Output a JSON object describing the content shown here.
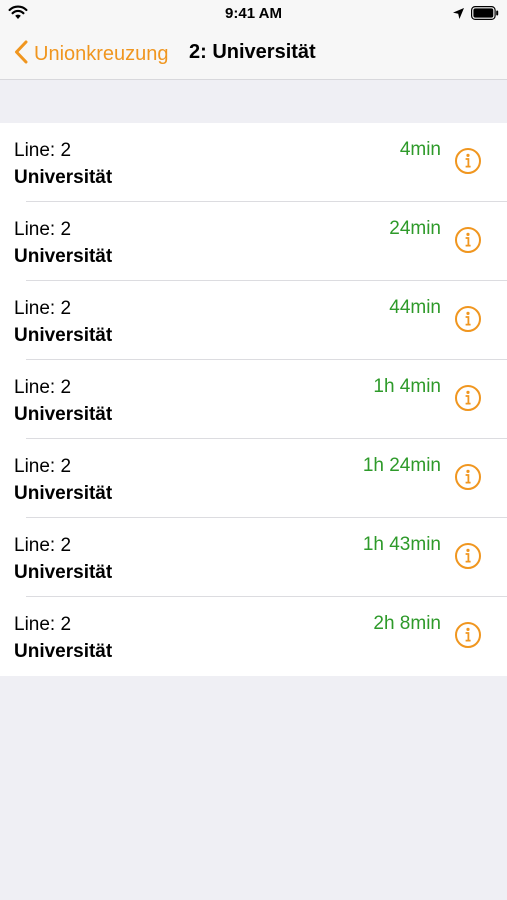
{
  "status_bar": {
    "time": "9:41 AM",
    "icons": [
      "wifi-icon",
      "location-icon",
      "battery-icon"
    ]
  },
  "nav": {
    "back_label": "Unionkreuzung",
    "title": "2: Universität"
  },
  "colors": {
    "accent": "#f0961f",
    "time_green": "#2e9a2a",
    "background": "#efeff4"
  },
  "departures": [
    {
      "line": "Line: 2",
      "destination": "Universität",
      "time": "4min"
    },
    {
      "line": "Line: 2",
      "destination": "Universität",
      "time": "24min"
    },
    {
      "line": "Line: 2",
      "destination": "Universität",
      "time": "44min"
    },
    {
      "line": "Line: 2",
      "destination": "Universität",
      "time": "1h 4min"
    },
    {
      "line": "Line: 2",
      "destination": "Universität",
      "time": "1h 24min"
    },
    {
      "line": "Line: 2",
      "destination": "Universität",
      "time": "1h 43min"
    },
    {
      "line": "Line: 2",
      "destination": "Universität",
      "time": "2h 8min"
    }
  ]
}
